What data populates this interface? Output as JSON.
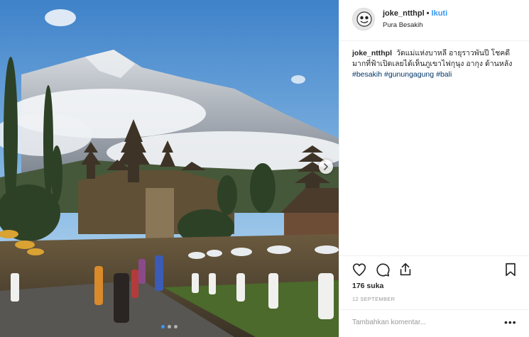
{
  "header": {
    "username": "joke_ntthpl",
    "separator": "•",
    "follow_label": "Ikuti",
    "location": "Pura Besakih"
  },
  "caption": {
    "username": "joke_ntthpl",
    "text": "วัดแม่แห่งบาหลี อายุราวพันปี โชคดีมากที่ฟ้าเปิดเลยได้เห็นภูเขาไฟกุนุง อากุง ด้านหลัง",
    "hashtags": [
      "#besakih",
      "#gunungagung",
      "#bali"
    ]
  },
  "post": {
    "likes": "176 suka",
    "date": "12 SEPTEMBER",
    "comment_placeholder": "Tambahkan komentar...",
    "more_label": "•••"
  },
  "carousel": {
    "slide_count": 3,
    "active_index": 0
  },
  "icons": {
    "like": "heart-icon",
    "comment": "comment-icon",
    "share": "share-icon",
    "save": "bookmark-icon",
    "next": "chevron-right-icon"
  },
  "colors": {
    "link_blue": "#3897f0",
    "hashtag_blue": "#003569",
    "muted_gray": "#999999",
    "divider": "#efefef"
  }
}
